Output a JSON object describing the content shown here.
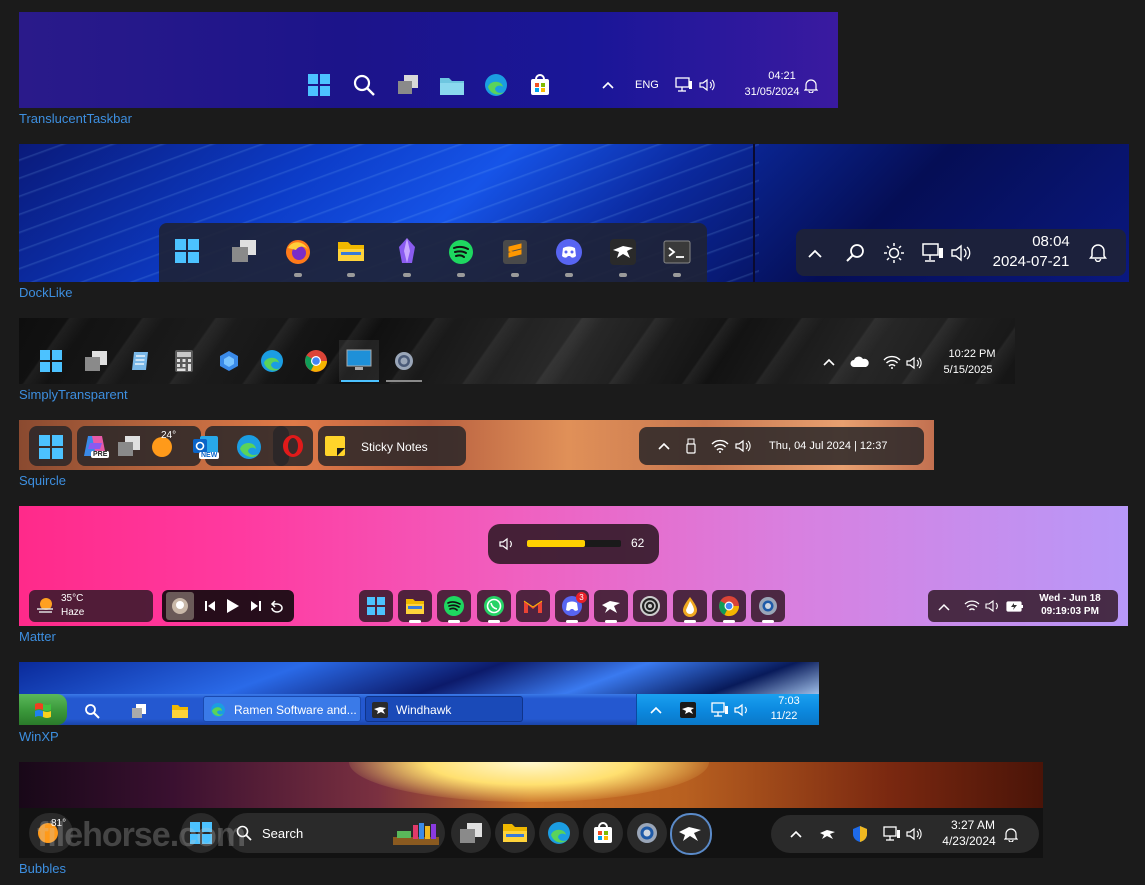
{
  "labels": {
    "translucent": "TranslucentTaskbar",
    "docklike": "DockLike",
    "simply": "SimplyTransparent",
    "squircle": "Squircle",
    "matter": "Matter",
    "winxp": "WinXP",
    "bubbles": "Bubbles"
  },
  "translucent": {
    "lang": "ENG",
    "time": "04:21",
    "date": "31/05/2024",
    "icons": [
      "windows-logo-icon",
      "search-icon",
      "task-view-icon",
      "folder-icon",
      "edge-icon",
      "store-icon",
      "chevron-up-icon",
      "network-icon",
      "volume-icon",
      "bell-icon"
    ]
  },
  "docklike": {
    "time": "08:04",
    "date": "2024-07-21",
    "apps": [
      "windows-logo-icon",
      "task-view-icon",
      "firefox-icon",
      "folder-icon",
      "obsidian-icon",
      "spotify-icon",
      "sublime-icon",
      "discord-icon",
      "windhawk-icon",
      "terminal-icon"
    ],
    "tray": [
      "chevron-up-icon",
      "search-icon",
      "brightness-icon",
      "network-icon",
      "volume-icon",
      "bell-icon"
    ]
  },
  "simply": {
    "time": "10:22 PM",
    "date": "5/15/2025",
    "apps": [
      "windows-logo-icon",
      "task-view-icon",
      "notepad-icon",
      "calculator-icon",
      "widget-icon",
      "edge-icon",
      "chrome-icon",
      "display-icon",
      "settings-icon"
    ],
    "tray": [
      "chevron-up-icon",
      "cloud-icon",
      "wifi-icon",
      "volume-icon"
    ]
  },
  "squircle": {
    "copilot_badge": "PRE",
    "weather_temp": "24°",
    "outlook_badge": "NEW",
    "sticky_label": "Sticky Notes",
    "datetime": "Thu, 04 Jul 2024 | 12:37"
  },
  "matter": {
    "volume_value": "62",
    "volume_level": 0.62,
    "weather_temp": "35°C",
    "weather_cond": "Haze",
    "discord_badge": "3",
    "tray_date": "Wed - Jun 18",
    "tray_time": "09:19:03 PM",
    "apps": [
      "windows-logo-icon",
      "folder-icon",
      "spotify-icon",
      "whatsapp-icon",
      "gmail-icon",
      "discord-icon",
      "windhawk-icon",
      "obs-icon",
      "inkdrop-icon",
      "chrome-icon",
      "settings-icon"
    ]
  },
  "winxp": {
    "task1": "Ramen Software and...",
    "task2": "Windhawk",
    "time": "7:03",
    "date": "11/22"
  },
  "bubbles": {
    "weather_temp": "81°",
    "search_placeholder": "Search",
    "time": "3:27 AM",
    "date": "4/23/2024",
    "watermark": "filehorse.com"
  },
  "colors": {
    "label_link": "#3d8fe0",
    "windows_blue": "#3aa0ea",
    "spotify_green": "#1ed760",
    "discord_blurple": "#5865f2",
    "xp_green": "#3c9a3c",
    "xp_blue": "#2468d8"
  }
}
